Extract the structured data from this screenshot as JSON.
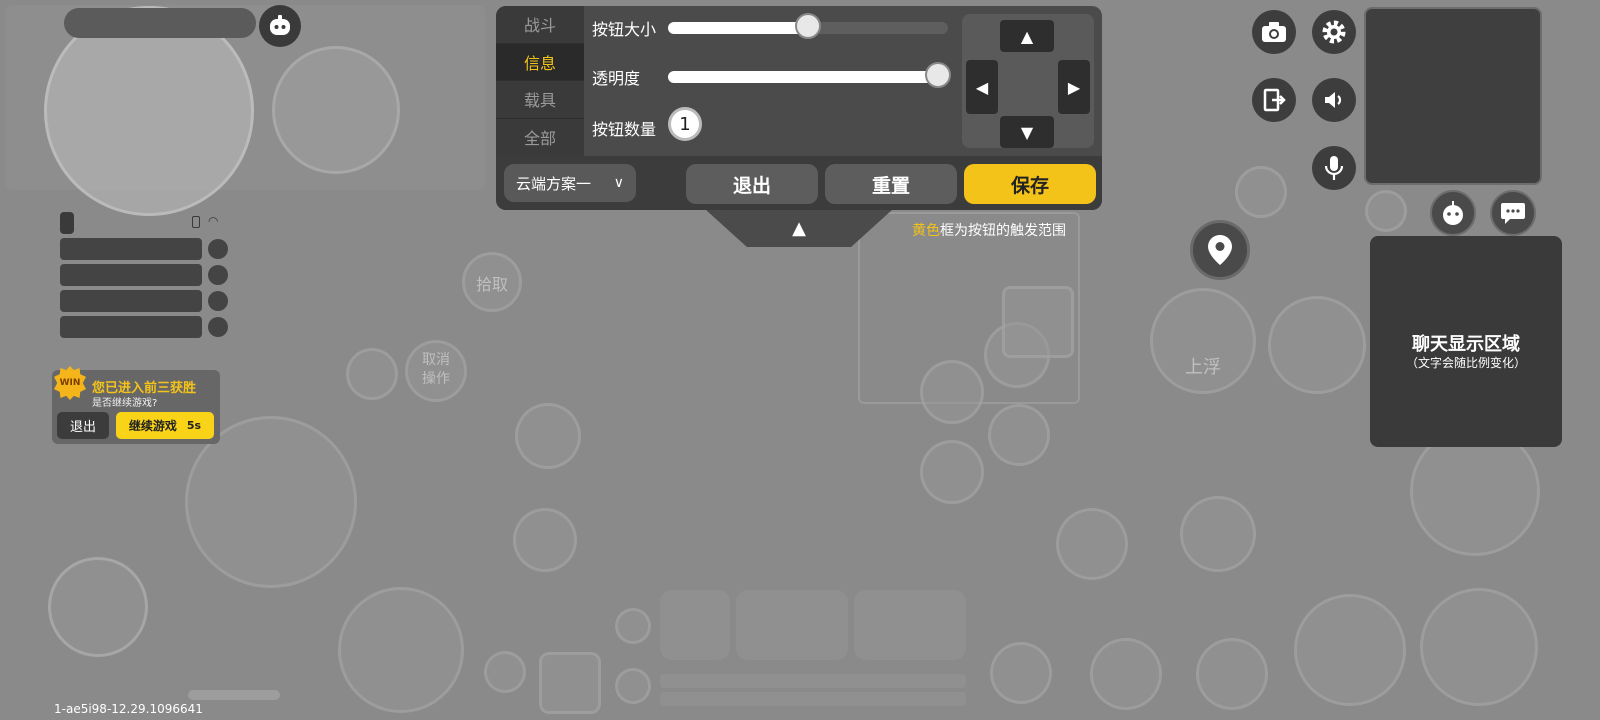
{
  "editor": {
    "tabs": [
      {
        "label": "战斗",
        "active": false
      },
      {
        "label": "信息",
        "active": true
      },
      {
        "label": "载具",
        "active": false
      },
      {
        "label": "全部",
        "active": false
      }
    ],
    "size_label": "按钮大小",
    "size_value": 0.5,
    "opacity_label": "透明度",
    "opacity_value": 1.0,
    "count_label": "按钮数量",
    "count_value": "1",
    "scheme_label": "云端方案一",
    "exit_label": "退出",
    "reset_label": "重置",
    "save_label": "保存",
    "hint_yellow": "黄色",
    "hint_rest": "框为按钮的触发范围",
    "accent_color": "#f4c31a"
  },
  "toast": {
    "title": "您已进入前三获胜",
    "subtitle": "是否继续游戏?",
    "exit_label": "退出",
    "continue_label": "继续游戏",
    "countdown": "5s",
    "badge": "WIN"
  },
  "chat": {
    "title": "聊天显示区域",
    "subtitle": "（文字会随比例变化）"
  },
  "ghost_labels": {
    "float": "上浮",
    "cancel": "取消\n操作",
    "pick": "拾取"
  },
  "version": "1-ae5i98-12.29.1096641",
  "icons": {
    "top_right": [
      "camera-icon",
      "settings-gear-icon",
      "exit-door-icon",
      "speaker-icon",
      "microphone-icon"
    ],
    "location": "map-pin-icon",
    "emote": "emoji-face-icon",
    "chat_bubble": "chat-bubble-icon"
  }
}
